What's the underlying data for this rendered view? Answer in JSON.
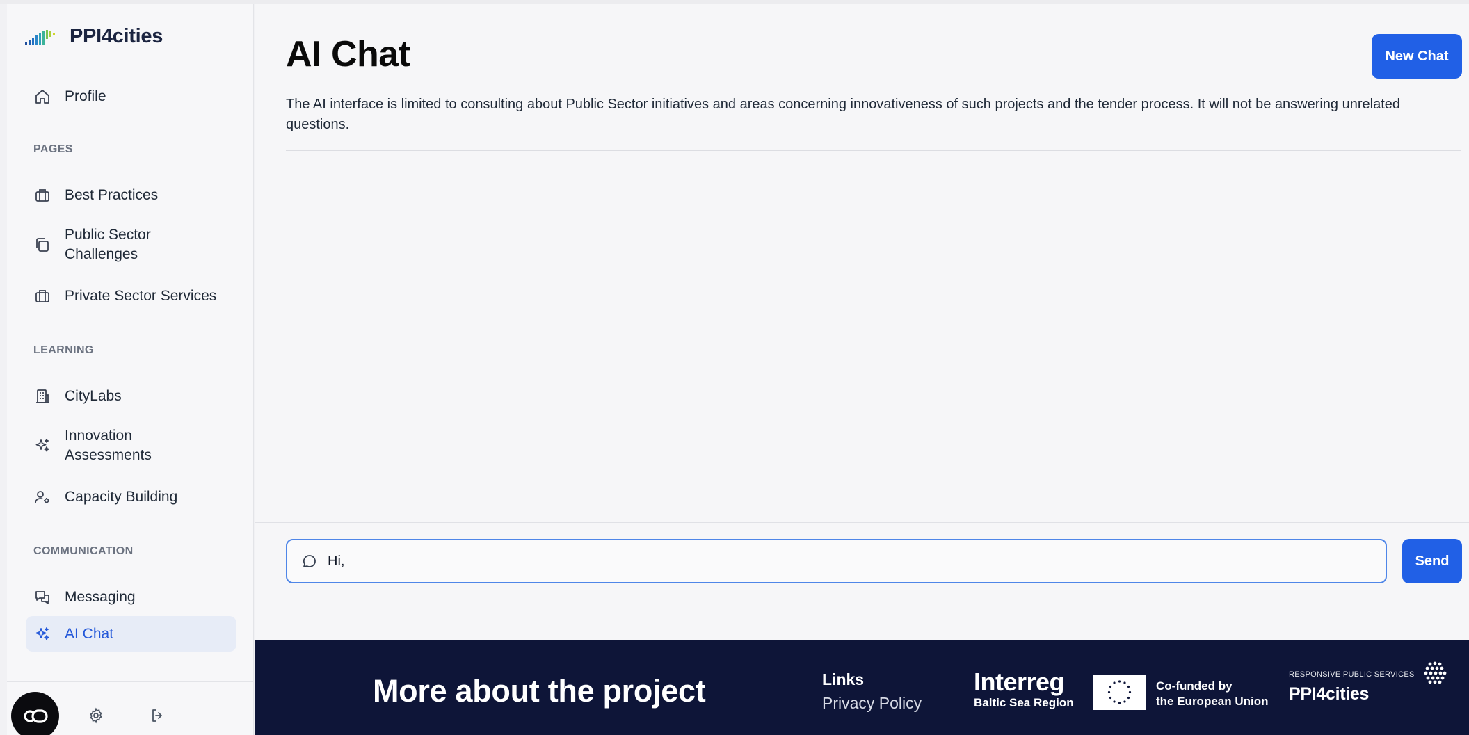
{
  "brand": {
    "name": "PPI4cities"
  },
  "sidebar": {
    "profile": {
      "label": "Profile",
      "icon": "home-icon"
    },
    "sections": {
      "pages": "PAGES",
      "learning": "LEARNING",
      "communication": "COMMUNICATION"
    },
    "items": [
      {
        "label": "Best Practices",
        "icon": "briefcase-icon"
      },
      {
        "label": "Public Sector Challenges",
        "icon": "copy-icon"
      },
      {
        "label": "Private Sector Services",
        "icon": "briefcase-icon"
      },
      {
        "label": "CityLabs",
        "icon": "building-icon"
      },
      {
        "label": "Innovation Assessments",
        "icon": "sparkles-icon"
      },
      {
        "label": "Capacity Building",
        "icon": "user-gear-icon"
      },
      {
        "label": "Messaging",
        "icon": "chat-bubbles-icon"
      },
      {
        "label": "AI Chat",
        "icon": "sparkles-icon",
        "active": true
      }
    ],
    "footer": {
      "co_icon": "co-logo-icon",
      "settings_icon": "gear-icon",
      "logout_icon": "logout-icon"
    }
  },
  "main": {
    "title": "AI Chat",
    "new_chat_label": "New Chat",
    "description": "The AI interface is limited to consulting about Public Sector initiatives and areas concerning innovativeness of such projects and the tender process. It will not be answering unrelated questions.",
    "composer": {
      "value": "Hi,",
      "icon": "message-circle-icon",
      "send_label": "Send"
    }
  },
  "footer": {
    "title": "More about the project",
    "links_heading": "Links",
    "privacy_label": "Privacy Policy",
    "interreg_big": "Interreg",
    "interreg_small": "Baltic Sea Region",
    "cofunded_line1": "Co-funded by",
    "cofunded_line2": "the European Union",
    "ppi_tag": "RESPONSIVE PUBLIC SERVICES",
    "ppi_name": "PPI4cities"
  },
  "colors": {
    "accent": "#2160e6",
    "sidebar_active_bg": "#e7ecf7",
    "footer_bg": "#0e1538"
  }
}
